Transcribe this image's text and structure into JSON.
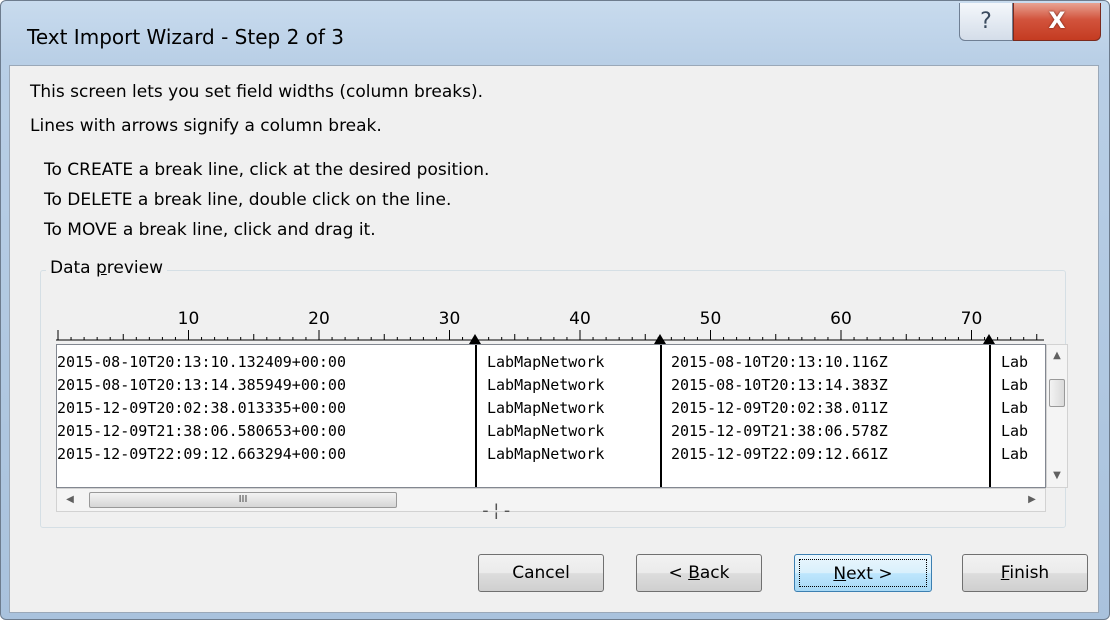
{
  "window": {
    "title": "Text Import Wizard - Step 2 of 3",
    "help_label": "?",
    "close_label": "X"
  },
  "instructions": {
    "line1": "This screen lets you set field widths (column breaks).",
    "line2": "Lines with arrows signify a column break.",
    "line3": "To CREATE a break line, click at the desired position.",
    "line4": "To DELETE a break line, double click on the line.",
    "line5": "To MOVE a break line, click and drag it."
  },
  "data_preview": {
    "label": "Data preview",
    "ruler_ticks": [
      "10",
      "20",
      "30",
      "40",
      "50",
      "60",
      "70"
    ],
    "rows": [
      [
        "2015-08-10T20:13:10.132409+00:00",
        "LabMapNetwork",
        "2015-08-10T20:13:10.116Z",
        "Lab"
      ],
      [
        "2015-08-10T20:13:14.385949+00:00",
        "LabMapNetwork",
        "2015-08-10T20:13:14.383Z",
        "Lab"
      ],
      [
        "2015-12-09T20:02:38.013335+00:00",
        "LabMapNetwork",
        "2015-12-09T20:02:38.011Z",
        "Lab"
      ],
      [
        "2015-12-09T21:38:06.580653+00:00",
        "LabMapNetwork",
        "2015-12-09T21:38:06.578Z",
        "Lab"
      ],
      [
        "2015-12-09T22:09:12.663294+00:00",
        "LabMapNetwork",
        "2015-12-09T22:09:12.661Z",
        "Lab"
      ]
    ],
    "hscroll_thumb_glyph": "III"
  },
  "buttons": {
    "cancel": "Cancel",
    "back": "< Back",
    "next": "Next >",
    "finish": "Finish"
  }
}
